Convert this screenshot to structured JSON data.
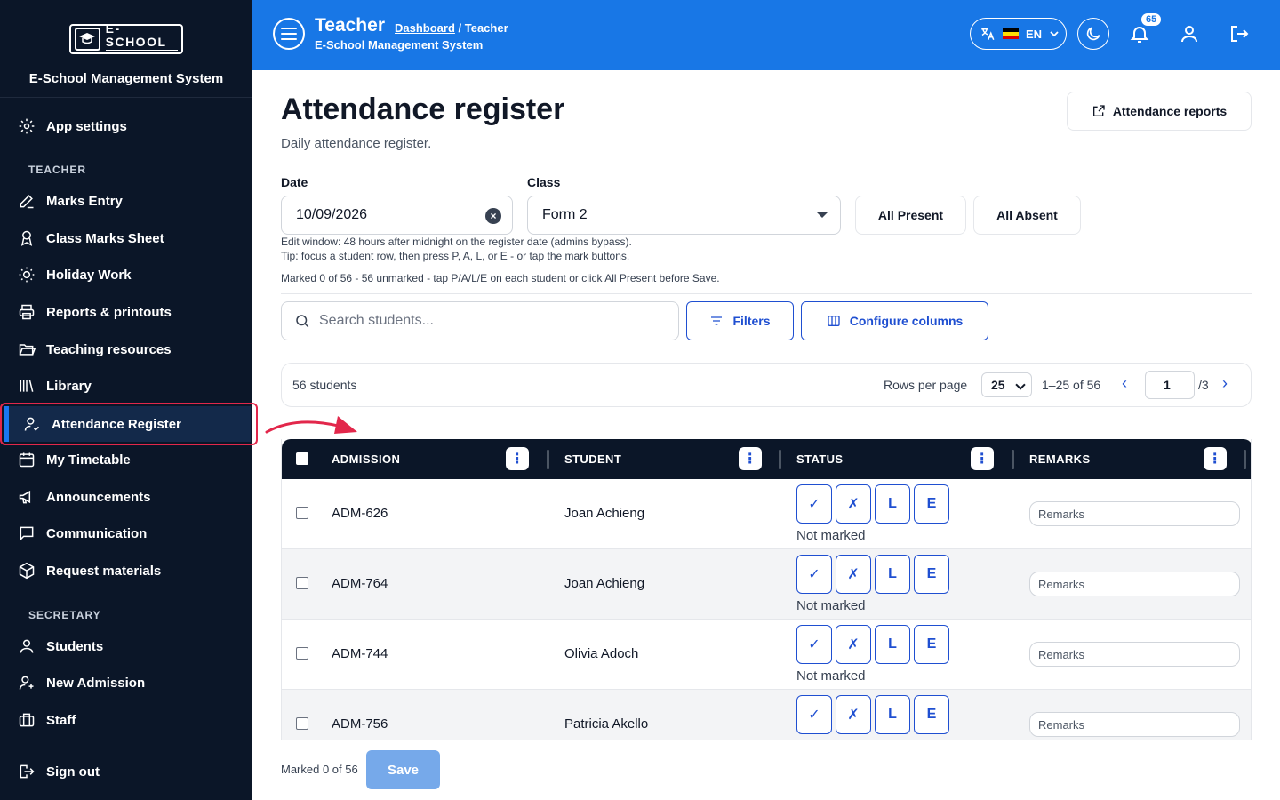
{
  "brand": {
    "logo_text": "E-SCHOOL",
    "logo_sub": "MANAGEMENT SYSTEM",
    "name": "E-School Management System"
  },
  "sidebar": {
    "app_settings": "App settings",
    "teacher_section": "TEACHER",
    "teacher_items": [
      "Marks Entry",
      "Class Marks Sheet",
      "Holiday Work",
      "Reports & printouts",
      "Teaching resources",
      "Library",
      "Attendance Register",
      "My Timetable",
      "Announcements",
      "Communication",
      "Request materials"
    ],
    "secretary_section": "SECRETARY",
    "secretary_items": [
      "Students",
      "New Admission",
      "Staff"
    ],
    "sign_out": "Sign out"
  },
  "header": {
    "title": "Teacher",
    "breadcrumb_link": "Dashboard",
    "breadcrumb_current": " / Teacher",
    "subtitle": "E-School Management System",
    "lang": "EN",
    "notif_count": "65"
  },
  "page": {
    "title": "Attendance register",
    "subtitle": "Daily attendance register.",
    "reports_button": "Attendance reports",
    "date_label": "Date",
    "date_value": "10/09/2026",
    "class_label": "Class",
    "class_value": "Form 2",
    "all_present": "All Present",
    "all_absent": "All Absent",
    "edit_window": "Edit window: 48 hours after midnight on the register date (admins bypass).",
    "tip": "Tip: focus a student row, then press P, A, L, or E - or tap the mark buttons.",
    "marked_status": "Marked 0 of 56 - 56 unmarked - tap P/A/L/E on each student or click All Present before Save.",
    "search_placeholder": "Search students...",
    "filters": "Filters",
    "configure_columns": "Configure columns"
  },
  "pager": {
    "count": "56 students",
    "rows_per_page_label": "Rows per page",
    "rows_per_page": "25",
    "range": "1–25 of 56",
    "page": "1",
    "total_pages": "/3"
  },
  "table": {
    "columns": [
      "ADMISSION",
      "STUDENT",
      "STATUS",
      "REMARKS"
    ],
    "mark_labels": [
      "✓",
      "✗",
      "L",
      "E"
    ],
    "not_marked": "Not marked",
    "remarks_placeholder": "Remarks",
    "rows": [
      {
        "admission": "ADM-626",
        "student": "Joan Achieng"
      },
      {
        "admission": "ADM-764",
        "student": "Joan Achieng"
      },
      {
        "admission": "ADM-744",
        "student": "Olivia Adoch"
      },
      {
        "admission": "ADM-756",
        "student": "Patricia Akello"
      }
    ]
  },
  "footer": {
    "marked": "Marked 0 of 56",
    "save": "Save"
  },
  "colors": {
    "primary": "#1877e6",
    "sidebar": "#0b1628",
    "accent_outline": "#1f4fd1",
    "highlight": "#e2274b"
  }
}
